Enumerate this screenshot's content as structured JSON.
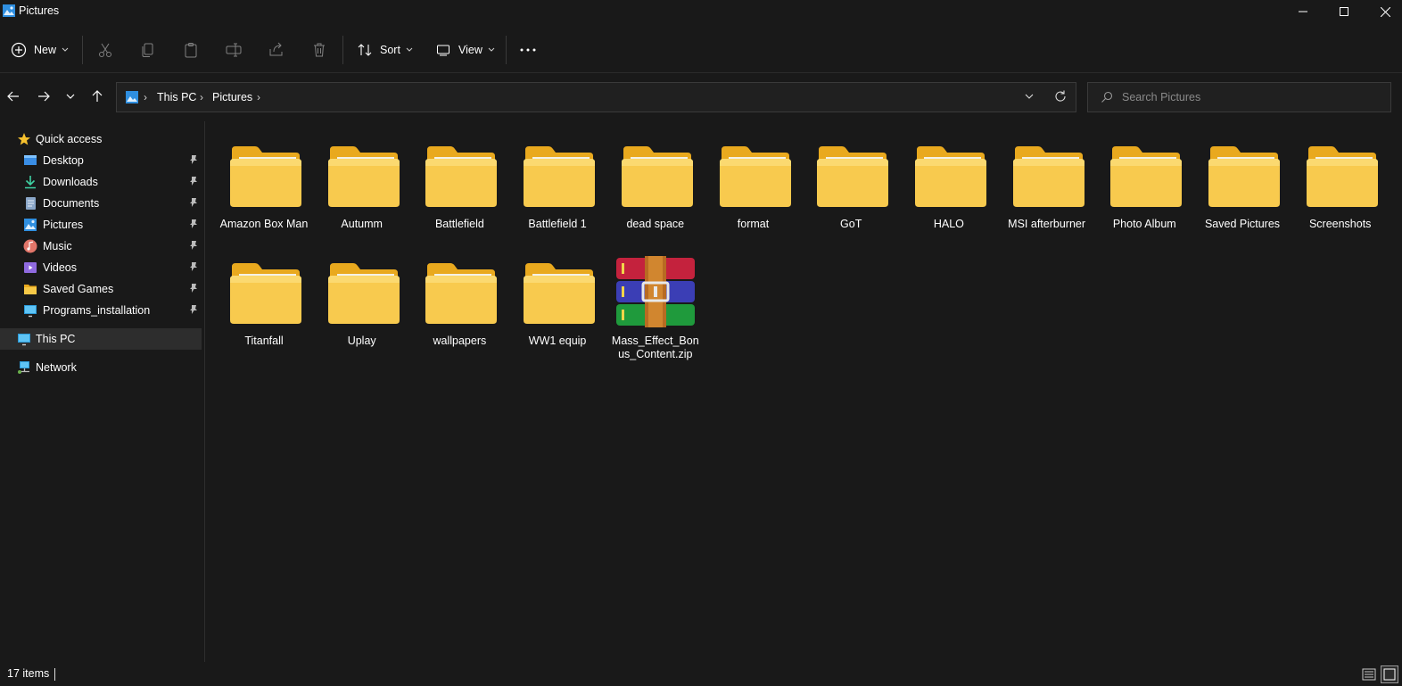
{
  "window": {
    "title": "Pictures"
  },
  "toolbar": {
    "new_label": "New",
    "sort_label": "Sort",
    "view_label": "View",
    "more_label": "•••"
  },
  "address": {
    "crumbs": [
      "This PC",
      "Pictures"
    ]
  },
  "search": {
    "placeholder": "Search Pictures"
  },
  "sidebar": {
    "quick_access": "Quick access",
    "items": [
      {
        "label": "Desktop",
        "icon": "desktop-icon"
      },
      {
        "label": "Downloads",
        "icon": "download-icon"
      },
      {
        "label": "Documents",
        "icon": "document-icon"
      },
      {
        "label": "Pictures",
        "icon": "pictures-icon"
      },
      {
        "label": "Music",
        "icon": "music-icon"
      },
      {
        "label": "Videos",
        "icon": "videos-icon"
      },
      {
        "label": "Saved Games",
        "icon": "folder-icon"
      },
      {
        "label": "Programs_installation",
        "icon": "monitor-icon"
      }
    ],
    "this_pc": "This PC",
    "network": "Network"
  },
  "items": [
    {
      "name": "Amazon Box Man",
      "type": "folder"
    },
    {
      "name": "Autumm",
      "type": "folder"
    },
    {
      "name": "Battlefield",
      "type": "folder"
    },
    {
      "name": "Battlefield 1",
      "type": "folder"
    },
    {
      "name": "dead space",
      "type": "folder"
    },
    {
      "name": "format",
      "type": "folder"
    },
    {
      "name": "GoT",
      "type": "folder"
    },
    {
      "name": "HALO",
      "type": "folder"
    },
    {
      "name": "MSI afterburner",
      "type": "folder"
    },
    {
      "name": "Photo Album",
      "type": "folder"
    },
    {
      "name": "Saved Pictures",
      "type": "folder"
    },
    {
      "name": "Screenshots",
      "type": "folder"
    },
    {
      "name": "Titanfall",
      "type": "folder"
    },
    {
      "name": "Uplay",
      "type": "folder"
    },
    {
      "name": "wallpapers",
      "type": "folder"
    },
    {
      "name": "WW1 equip",
      "type": "folder"
    },
    {
      "name": "Mass_Effect_Bonus_Content.zip",
      "type": "archive"
    }
  ],
  "status": {
    "count": "17 items"
  },
  "colors": {
    "background": "#191919",
    "folder": "#f5c84c",
    "accent": "#4cc2ff"
  }
}
